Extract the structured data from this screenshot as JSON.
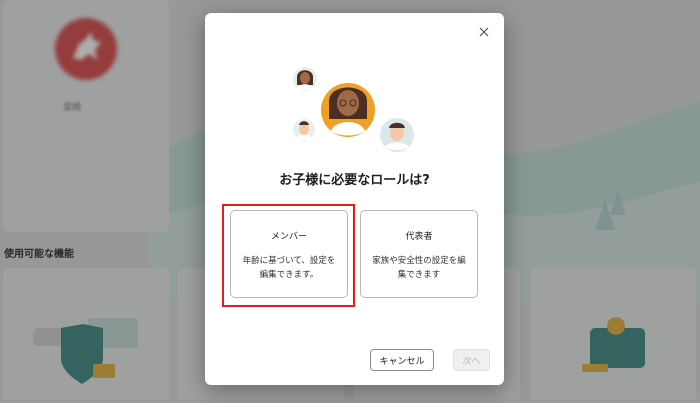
{
  "background": {
    "profile_name": "宮崎",
    "section_title": "使用可能な機能"
  },
  "dialog": {
    "title": "お子様に必要なロールは?",
    "close_icon": "close-icon",
    "roles": [
      {
        "title": "メンバー",
        "description": "年齢に基づいて、設定を編集できます。",
        "selected": true
      },
      {
        "title": "代表者",
        "description": "家族や安全性の設定を編集できます",
        "selected": false
      }
    ],
    "buttons": {
      "cancel_label": "キャンセル",
      "next_label": "次へ"
    }
  },
  "colors": {
    "highlight": "#e0201b",
    "avatar_accent": "#f0a024",
    "hill_teal": "#a9cfc9"
  }
}
